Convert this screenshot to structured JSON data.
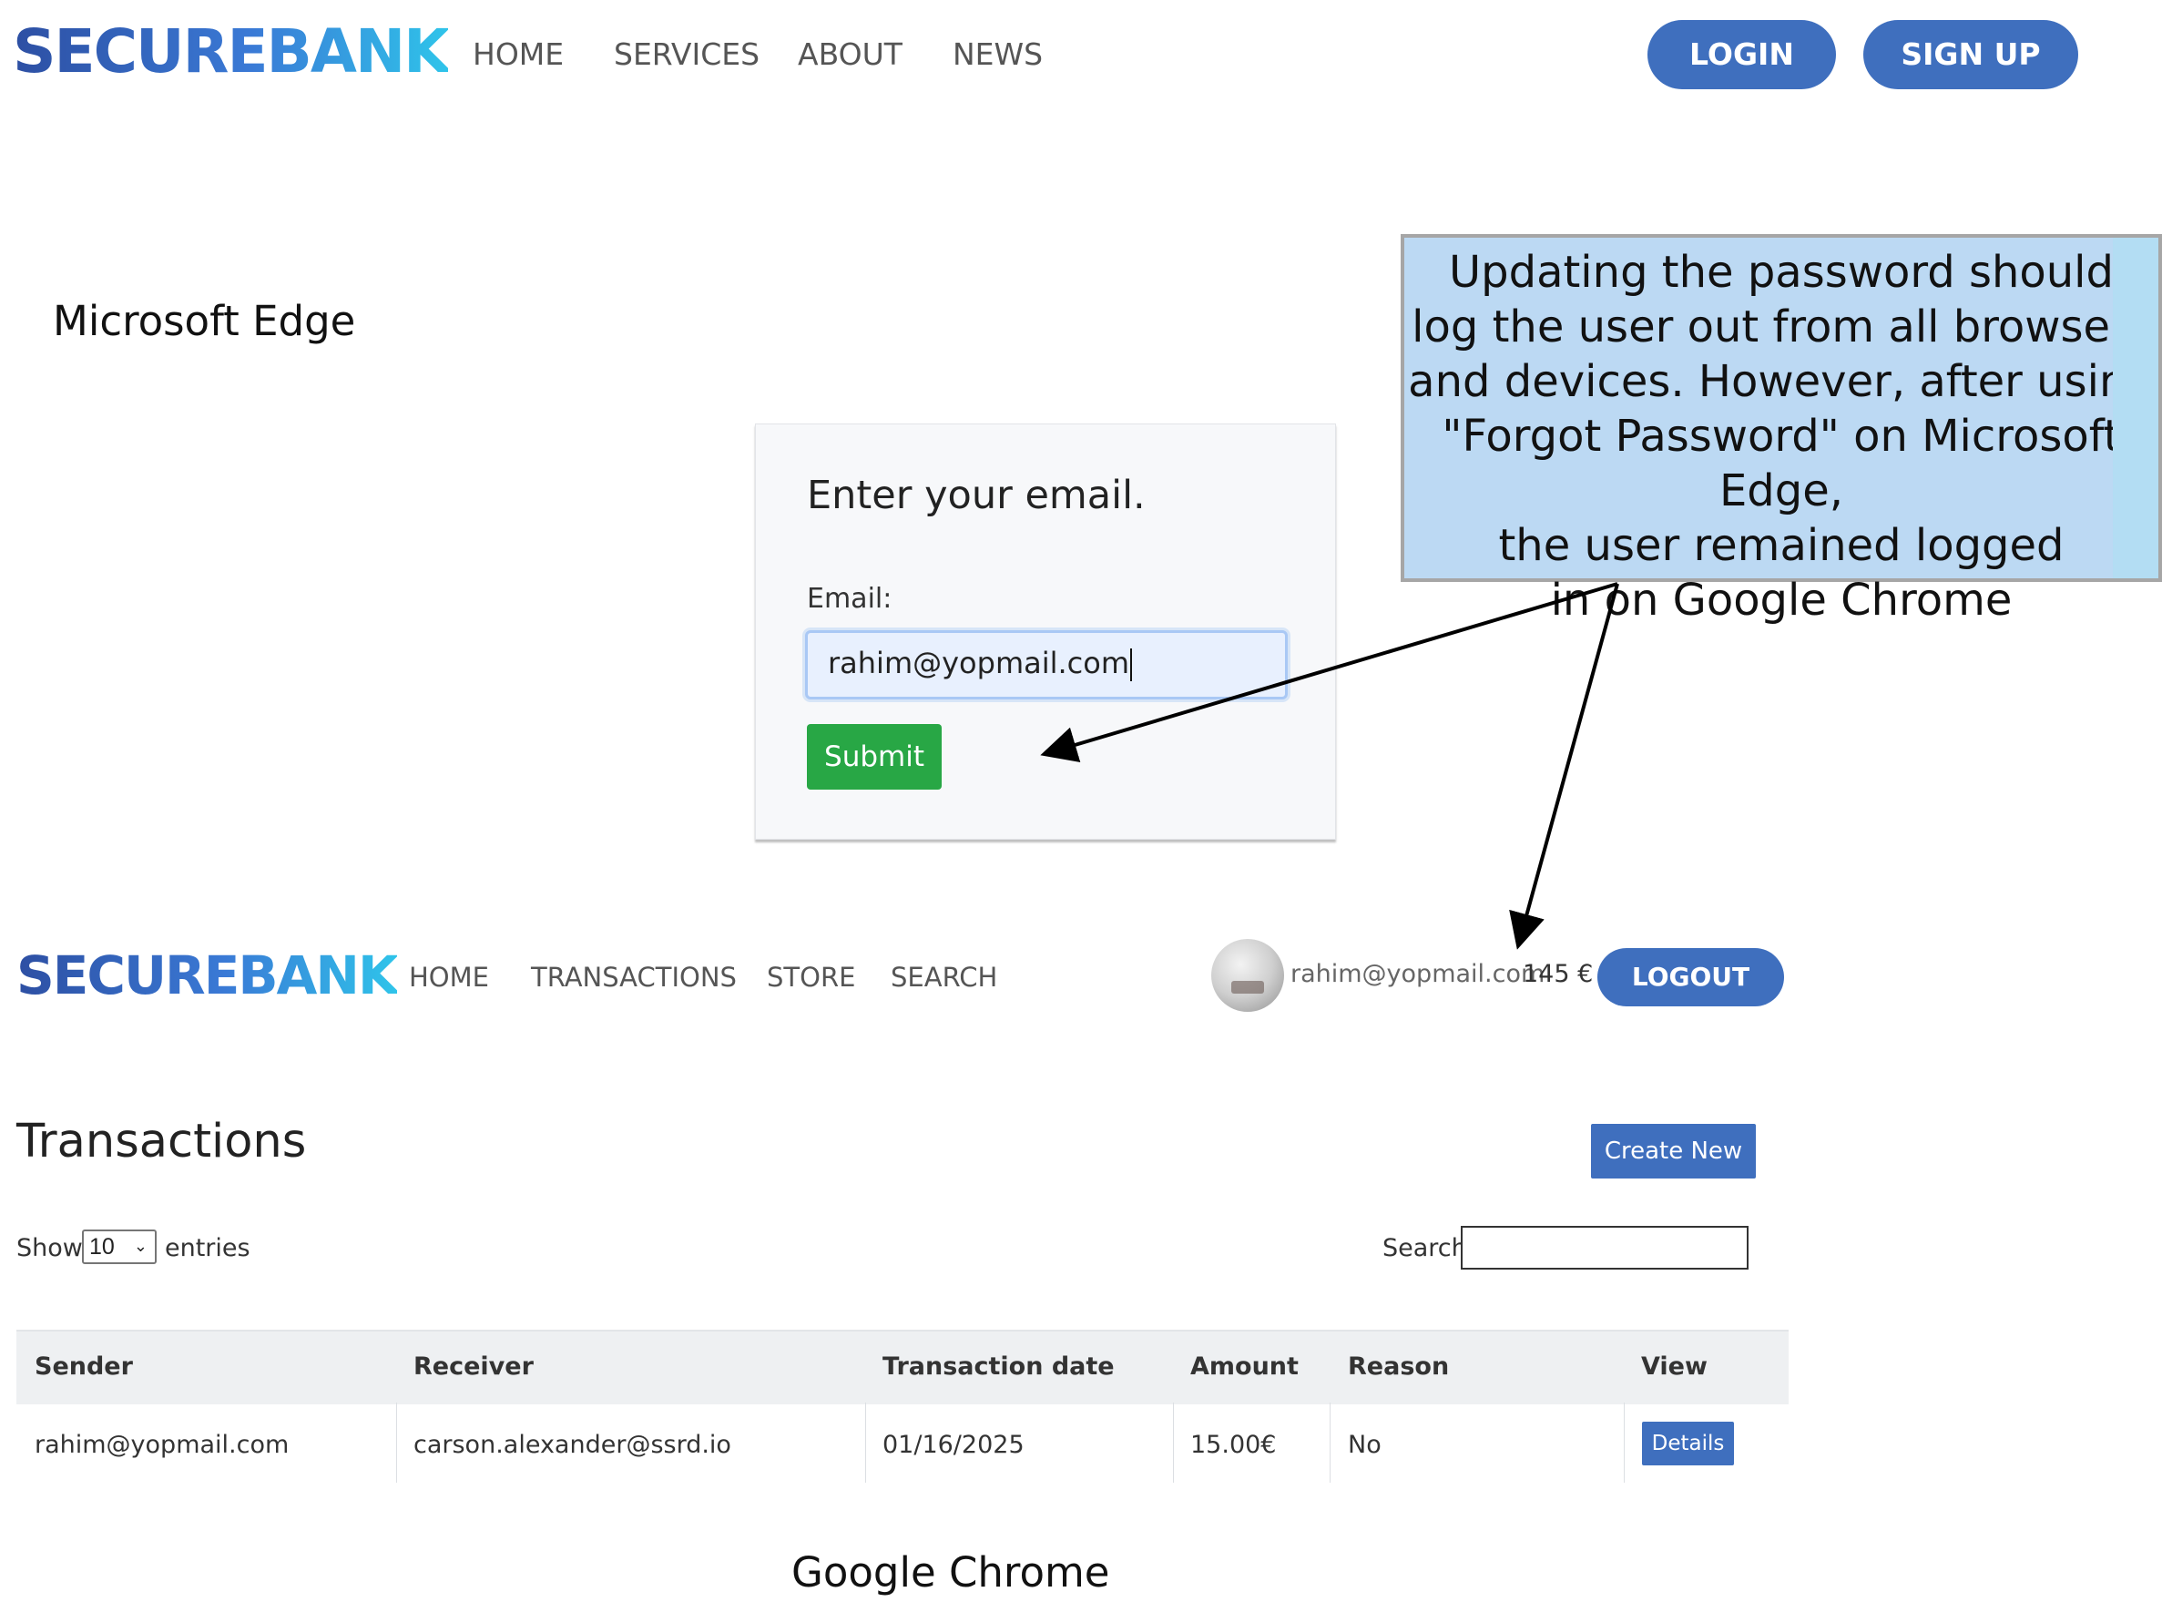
{
  "edge": {
    "brand": "SECUREBANK",
    "nav": [
      "HOME",
      "SERVICES",
      "ABOUT",
      "NEWS"
    ],
    "login_label": "LOGIN",
    "signup_label": "SIGN UP",
    "browser_caption": "Microsoft Edge",
    "form": {
      "title": "Enter your email.",
      "email_label": "Email:",
      "email_value": "rahim@yopmail.com",
      "submit_label": "Submit"
    }
  },
  "callout": {
    "lines": [
      "Updating the password should",
      "log the user out from all browsers",
      "and devices. However, after using",
      "\"Forgot Password\" on Microsoft Edge,",
      "the user remained logged",
      "in on Google Chrome"
    ]
  },
  "chrome": {
    "brand": "SECUREBANK",
    "nav": [
      "HOME",
      "TRANSACTIONS",
      "STORE",
      "SEARCH"
    ],
    "user_email": "rahim@yopmail.com",
    "balance": "145 €",
    "logout_label": "LOGOUT",
    "page_title": "Transactions",
    "create_label": "Create New",
    "show_label": "Show",
    "entries_value": "10",
    "entries_label": "entries",
    "search_label": "Search:",
    "table": {
      "headers": [
        "Sender",
        "Receiver",
        "Transaction date",
        "Amount",
        "Reason",
        "View"
      ],
      "rows": [
        {
          "sender": "rahim@yopmail.com",
          "receiver": "carson.alexander@ssrd.io",
          "date": "01/16/2025",
          "amount": "15.00€",
          "reason": "No",
          "view_label": "Details"
        }
      ]
    },
    "browser_caption": "Google Chrome"
  },
  "colors": {
    "primary_blue": "#3f6fbe",
    "submit_green": "#28a745",
    "callout_fill": "#bcd9f3"
  }
}
